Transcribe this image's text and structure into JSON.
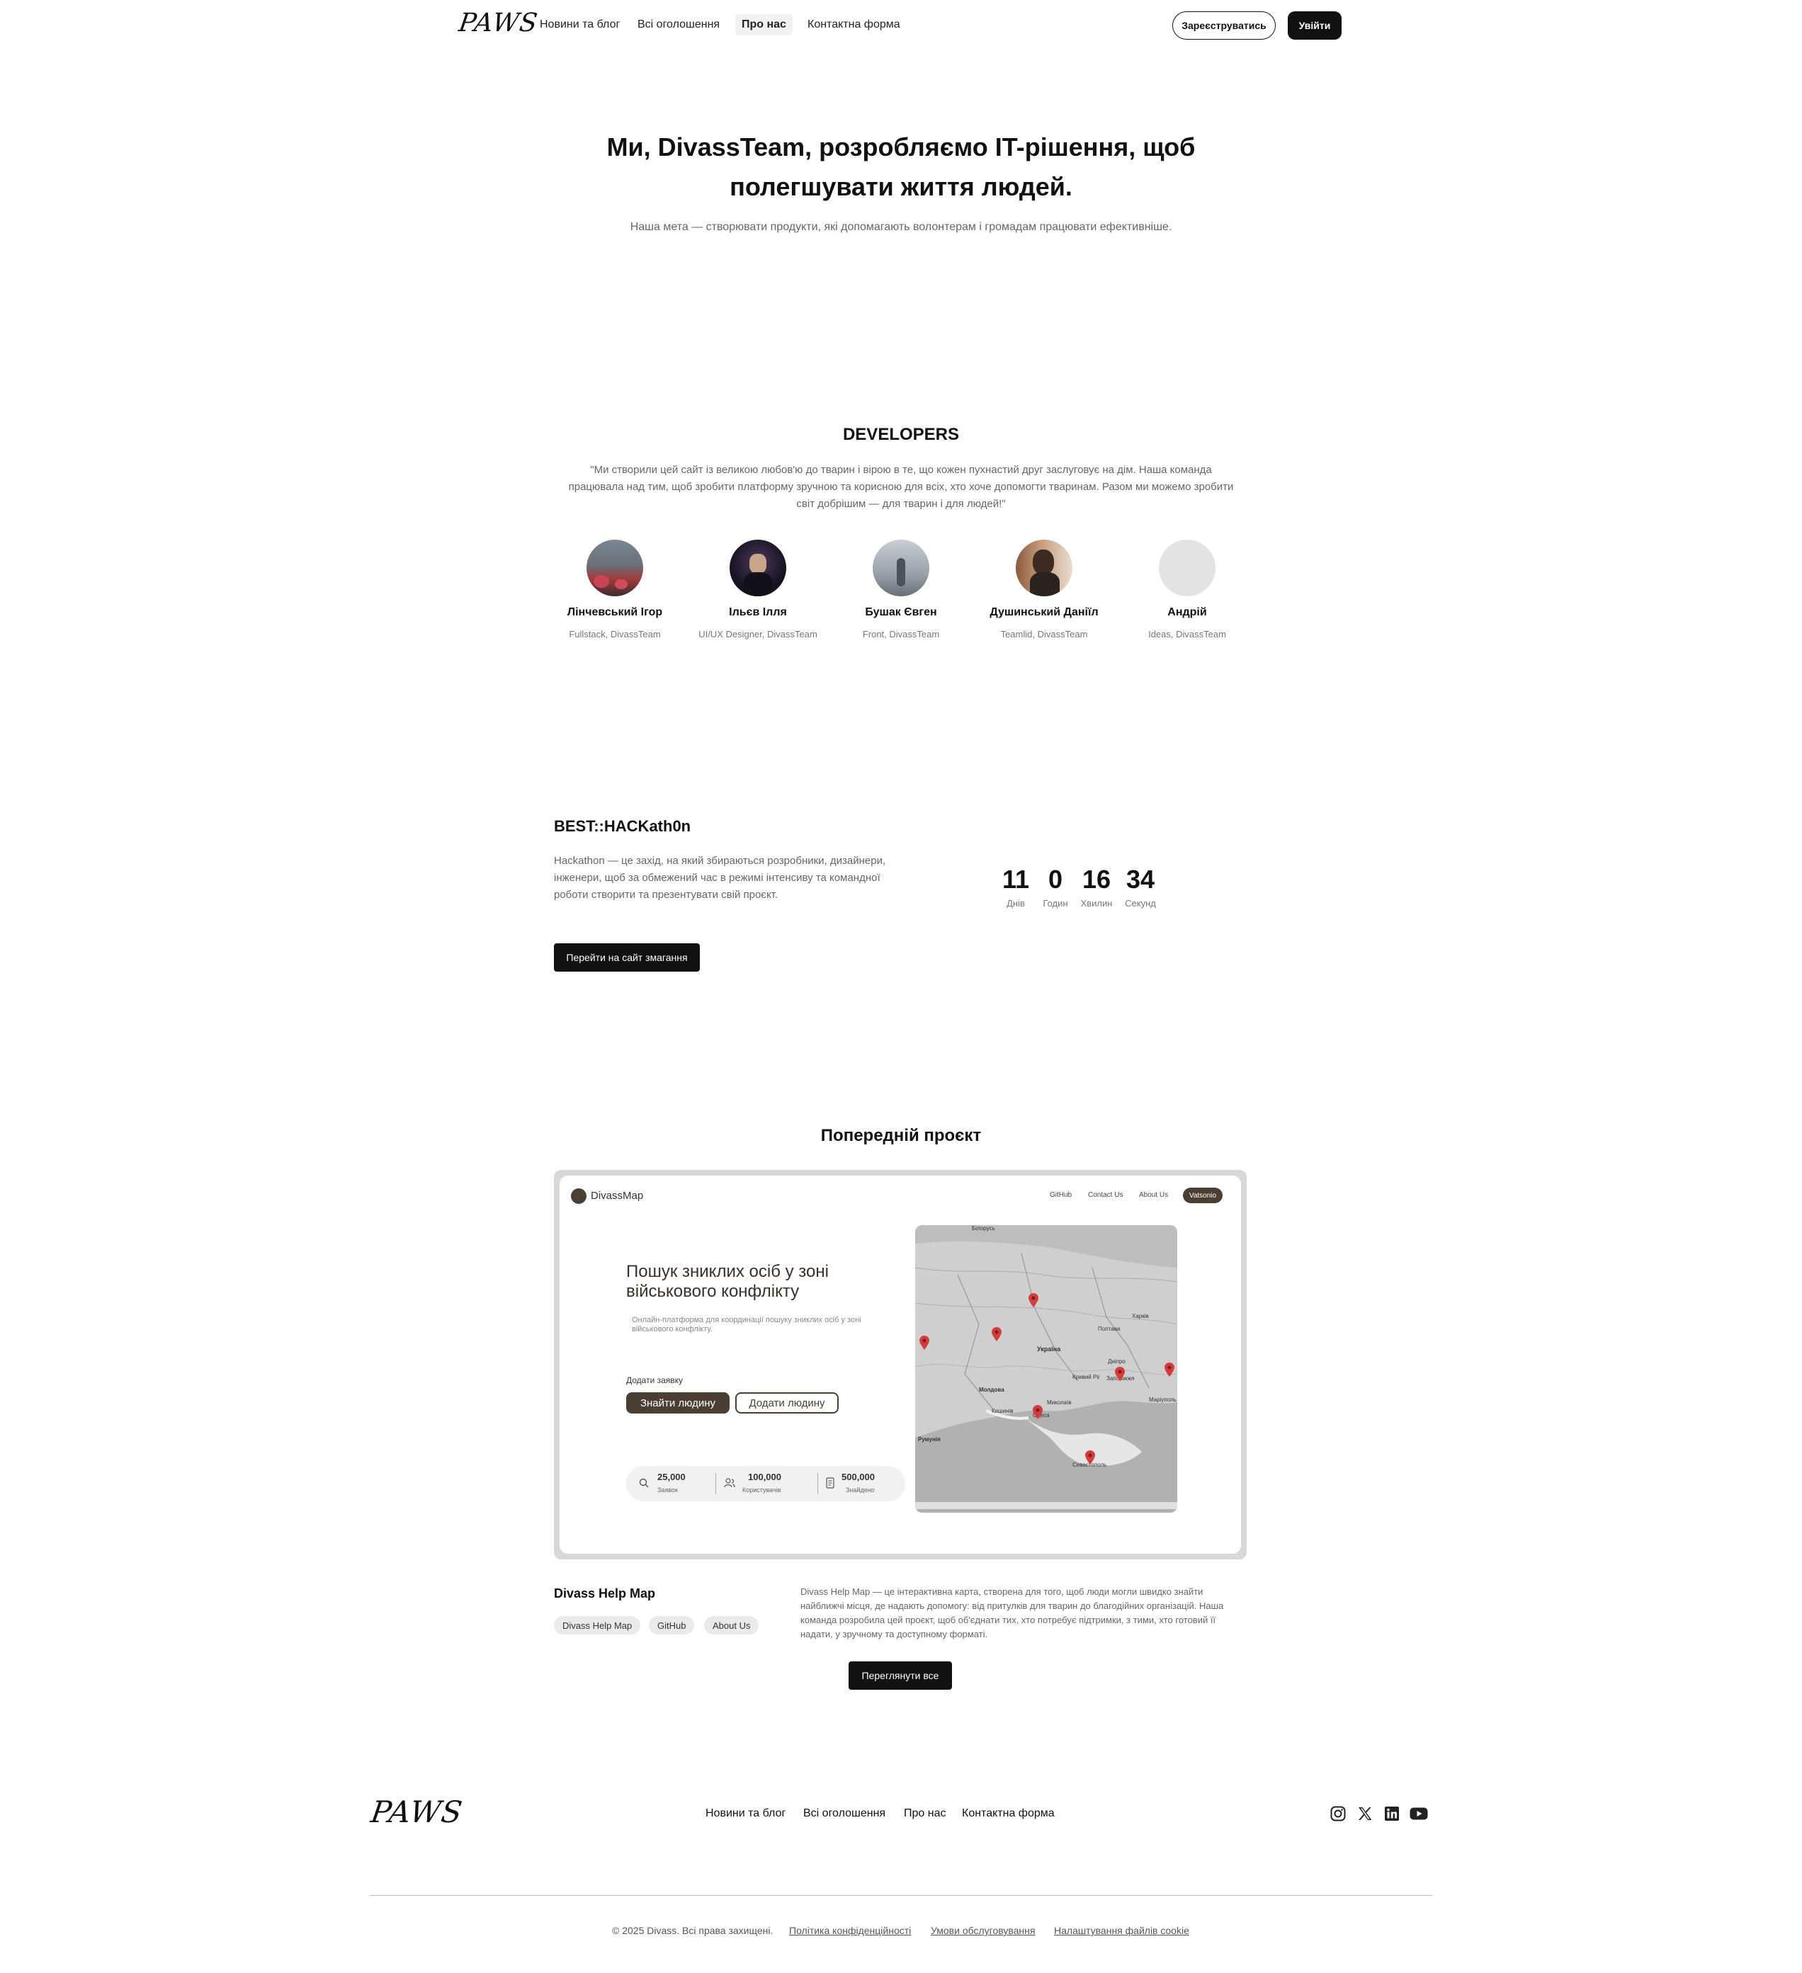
{
  "header": {
    "logo": "PAWS",
    "nav": [
      "Новини та блог",
      "Всі оголошення",
      "Про нас",
      "Контактна форма"
    ],
    "register": "Зареєструватись",
    "login": "Увійти"
  },
  "hero": {
    "title": "Ми, DivassTeam, розробляємо IT-рішення, щоб полегшувати життя людей.",
    "subtitle": "Наша мета — створювати продукти, які допомагають волонтерам і громадам працювати ефективніше."
  },
  "developers": {
    "title": "DEVELOPERS",
    "quote": "\"Ми створили цей сайт із великою любов'ю до тварин і вірою в те, що кожен пухнастий друг заслуговує на дім. Наша команда працювала над тим, щоб зробити платформу зручною та корисною для всіх, хто хоче допомогти тваринам. Разом ми можемо зробити світ добрішим — для тварин і для людей!\"",
    "people": [
      {
        "name": "Лінчевський Ігор",
        "role": "Fullstack, DivassTeam"
      },
      {
        "name": "Ільєв Ілля",
        "role": "UI/UX Designer, DivassTeam"
      },
      {
        "name": "Бушак Євген",
        "role": "Front, DivassTeam"
      },
      {
        "name": "Душинський Даніїл",
        "role": "Teamlid, DivassTeam"
      },
      {
        "name": "Андрій",
        "role": "Ideas, DivassTeam"
      }
    ]
  },
  "hackathon": {
    "title": "BEST::HACKath0n",
    "text": "Hackathon — це захід, на який збираються розробники, дизайнери, інженери, щоб за обмежений час в режимі інтенсиву та командної роботи створити та презентувати свій проєкт.",
    "button": "Перейти на сайт змагання",
    "countdown": [
      {
        "value": "11",
        "label": "Днів"
      },
      {
        "value": "0",
        "label": "Годин"
      },
      {
        "value": "16",
        "label": "Хвилин"
      },
      {
        "value": "34",
        "label": "Секунд"
      }
    ]
  },
  "previous": {
    "title": "Попередній проєкт",
    "screenshot": {
      "logo": "DivassMap",
      "nav": [
        "GitHub",
        "Contact Us",
        "About Us"
      ],
      "pill": "Vatsonio",
      "title": "Пошук зниклих осіб у зоні військового конфлікту",
      "subtitle": "Онлайн-платформа для координації пошуку зниклих осіб у зоні військового конфлікту.",
      "add_label": "Додати заявку",
      "btn_find": "Знайти людину",
      "btn_add": "Додати людину",
      "stats": [
        {
          "value": "25,000",
          "label": "Заявок"
        },
        {
          "value": "100,000",
          "label": "Користувачів"
        },
        {
          "value": "500,000",
          "label": "Знайдено"
        }
      ],
      "map_labels": [
        "Білорусь",
        "Україна",
        "Молдова",
        "Румунія",
        "Харків",
        "Полтава",
        "Дніпро",
        "Кривий Ріг",
        "Запоріжжя",
        "Маріуполь",
        "Миколаїв",
        "Одеса",
        "Кишинів",
        "Севастополь"
      ]
    },
    "project_name": "Divass Help Map",
    "tags": [
      "Divass Help Map",
      "GitHub",
      "About Us"
    ],
    "description": "Divass Help Map — це інтерактивна карта, створена для того, щоб люди могли швидко знайти найближчі місця, де надають допомогу: від притулків для тварин до благодійних організацій. Наша команда розробила цей проєкт, щоб об'єднати тих, хто потребує підтримки, з тими, хто готовий її надати, у зручному та доступному форматі.",
    "view_all": "Переглянути все"
  },
  "footer": {
    "logo": "PAWS",
    "nav": [
      "Новини та блог",
      "Всі оголошення",
      "Про нас",
      "Контактна форма"
    ],
    "social_icons": [
      "instagram-icon",
      "x-icon",
      "linkedin-icon",
      "youtube-icon"
    ],
    "copyright": "© 2025 Divass. Всі права захищені.",
    "links": [
      "Політика конфіденційності",
      "Умови обслуговування",
      "Налаштування файлів cookie"
    ]
  }
}
